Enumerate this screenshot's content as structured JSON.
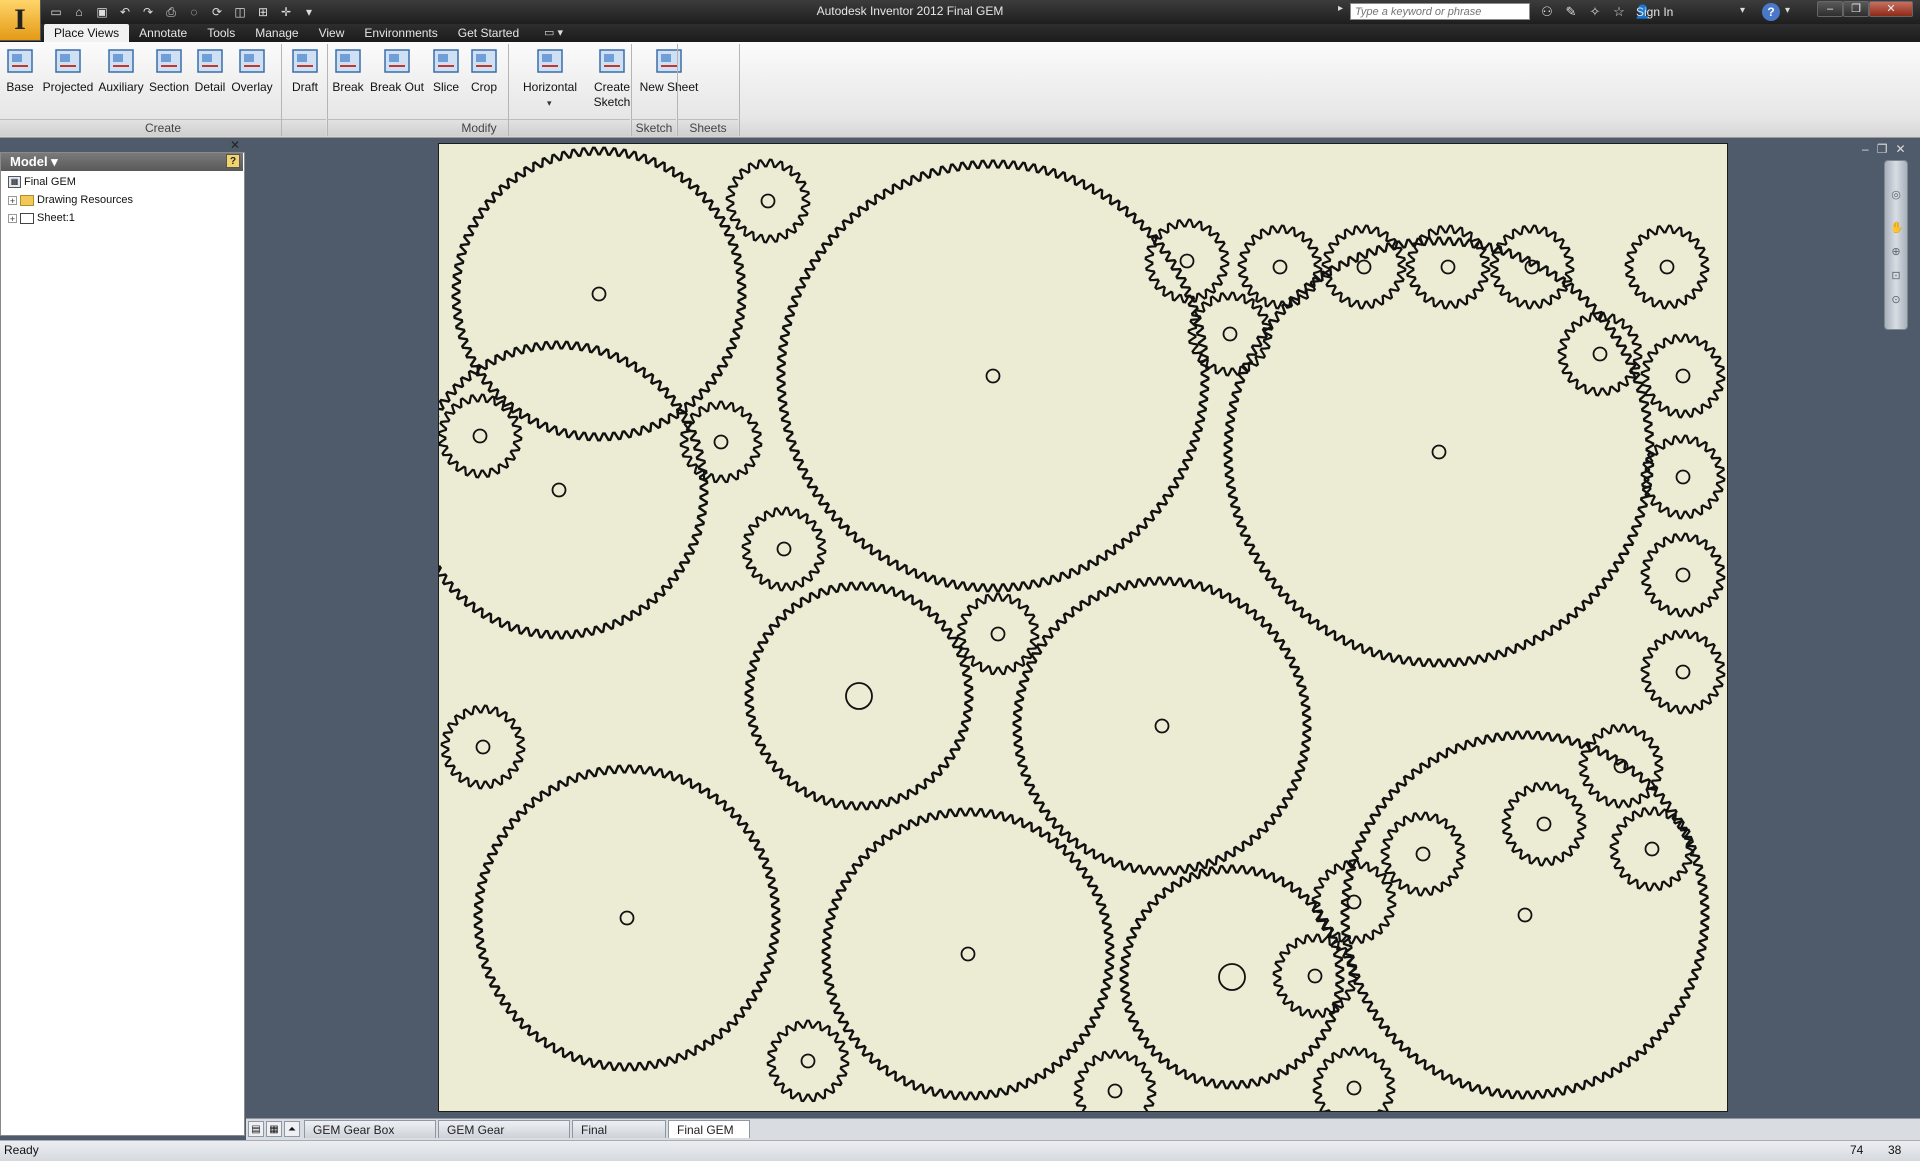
{
  "title_bar": {
    "window_title": "Autodesk Inventor 2012   Final GEM",
    "search_placeholder": "Type a keyword or phrase",
    "sign_in": "Sign In",
    "help": "?"
  },
  "ribbon_tabs": [
    "Place Views",
    "Annotate",
    "Tools",
    "Manage",
    "View",
    "Environments",
    "Get Started"
  ],
  "ribbon": {
    "buttons": [
      {
        "label": "Base",
        "icon": "base-view-icon"
      },
      {
        "label": "Projected",
        "icon": "projected-view-icon"
      },
      {
        "label": "Auxiliary",
        "icon": "auxiliary-view-icon"
      },
      {
        "label": "Section",
        "icon": "section-view-icon"
      },
      {
        "label": "Detail",
        "icon": "detail-view-icon"
      },
      {
        "label": "Overlay",
        "icon": "overlay-view-icon"
      },
      {
        "label": "Draft",
        "icon": "draft-view-icon"
      },
      {
        "label": "Break",
        "icon": "break-icon"
      },
      {
        "label": "Break Out",
        "icon": "break-out-icon"
      },
      {
        "label": "Slice",
        "icon": "slice-icon"
      },
      {
        "label": "Crop",
        "icon": "crop-icon"
      },
      {
        "label": "Horizontal",
        "icon": "horizontal-align-icon"
      },
      {
        "label": "Create\nSketch",
        "icon": "create-sketch-icon"
      },
      {
        "label": "New Sheet",
        "icon": "new-sheet-icon"
      }
    ],
    "panels": [
      "Create",
      "Modify",
      "Sketch",
      "Sheets"
    ]
  },
  "browser": {
    "title": "Model",
    "tree": [
      {
        "label": "Final GEM",
        "icon": "drawing-icon"
      },
      {
        "label": "Drawing Resources",
        "icon": "folder-icon"
      },
      {
        "label": "Sheet:1",
        "icon": "sheet-icon"
      }
    ]
  },
  "doc_tabs": [
    "GEM Gear Box a...iam",
    "GEM Gear Moun...idw",
    "Final GEM.iam",
    "Final GEM"
  ],
  "status": {
    "text": "Ready",
    "value1": "74",
    "value2": "38"
  },
  "colors": {
    "sheet": "#ecebd4",
    "graphics_bg": "#4f5b6a",
    "gear_stroke": "#111111"
  }
}
